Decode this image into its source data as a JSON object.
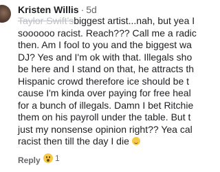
{
  "comment": {
    "author": "Kristen Willis",
    "separator": "·",
    "time": "5d",
    "struck_text": "Taylor Swift's",
    "lines": [
      "biggest artist...nah, but yea I",
      "soooooo racist. Reach??? Call me a radic",
      "then. Am I fool to you and the biggest wa",
      "DJ? Yes and I'm ok with that. Illegals sho",
      "be here and I stand on that, he attracts th",
      "Hispanic crowd therefore ice should be t",
      "cause I'm kinda over paying for free heal",
      "for a bunch of illegals. Damn I bet Ritchie",
      "them on his payroll under the table. But t",
      "just my nonsense opinion right?? Yea cal",
      "racist then till the day I die"
    ],
    "emoji_icon": "grinning-face-emoji"
  },
  "actions": {
    "reply_label": "Reply",
    "reaction_icon": "wow-face-icon",
    "reaction_count": "1"
  }
}
